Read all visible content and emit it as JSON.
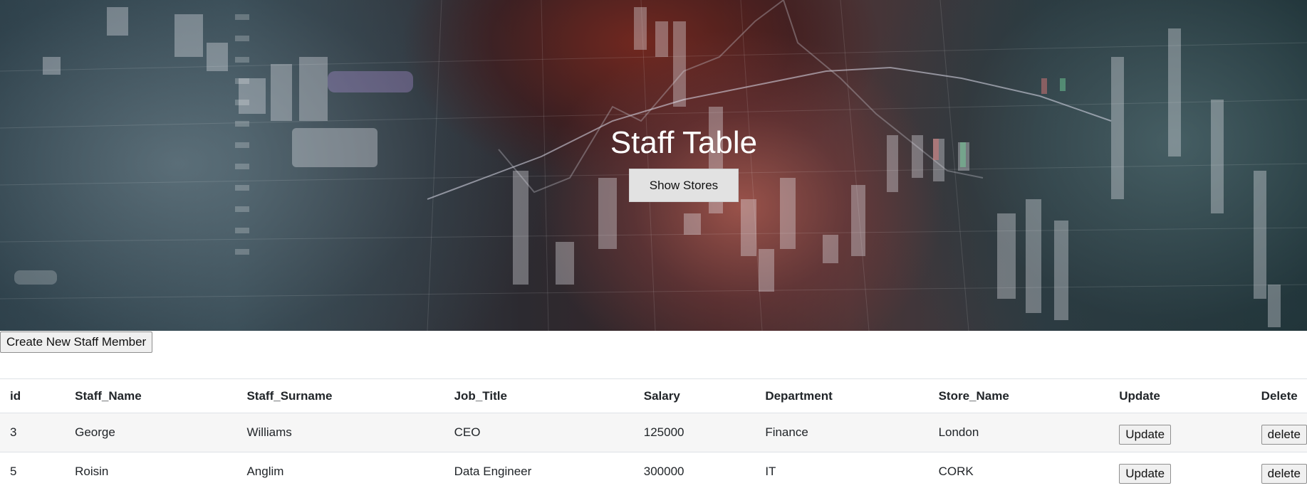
{
  "hero": {
    "title": "Staff Table",
    "show_stores_label": "Show Stores"
  },
  "actions": {
    "create_label": "Create New Staff Member"
  },
  "table": {
    "headers": [
      "id",
      "Staff_Name",
      "Staff_Surname",
      "Job_Title",
      "Salary",
      "Department",
      "Store_Name",
      "Update",
      "Delete"
    ],
    "rows": [
      {
        "id": "3",
        "staff_name": "George",
        "staff_surname": "Williams",
        "job_title": "CEO",
        "salary": "125000",
        "department": "Finance",
        "store_name": "London",
        "update_label": "Update",
        "delete_label": "delete"
      },
      {
        "id": "5",
        "staff_name": "Roisin",
        "staff_surname": "Anglim",
        "job_title": "Data Engineer",
        "salary": "300000",
        "department": "IT",
        "store_name": "CORK",
        "update_label": "Update",
        "delete_label": "delete"
      }
    ]
  }
}
